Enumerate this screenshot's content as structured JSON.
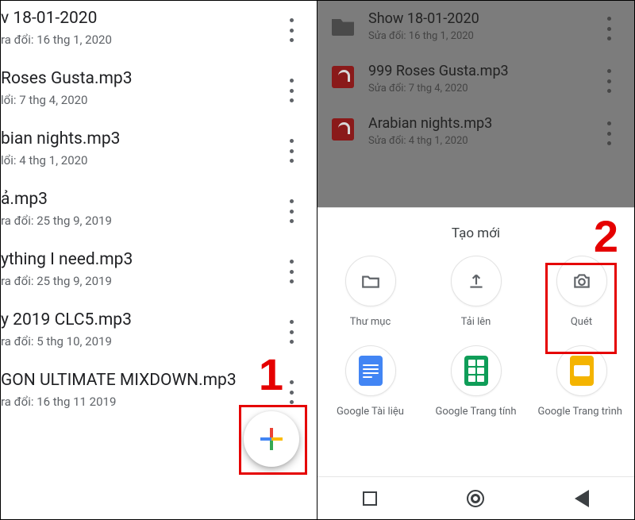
{
  "left": {
    "files": [
      {
        "title": "v 18-01-2020",
        "sub": "ra đổi: 16 thg 1, 2020"
      },
      {
        "title": "Roses Gusta.mp3",
        "sub": "lổi: 7 thg 4, 2020"
      },
      {
        "title": "bian nights.mp3",
        "sub": "lổi: 4 thg 1, 2020"
      },
      {
        "title": "ả.mp3",
        "sub": "ra đổi: 25 thg 9, 2019"
      },
      {
        "title": "ything I need.mp3",
        "sub": "ra đổi: 25 thg 9, 2019"
      },
      {
        "title": "y 2019 CLC5.mp3",
        "sub": "ra đổi: 5 thg 10, 2019"
      },
      {
        "title": "GON ULTIMATE MIXDOWN.mp3",
        "sub": "ra đổi: 16 thg 11  2019"
      }
    ],
    "callout_num": "1"
  },
  "right": {
    "files": [
      {
        "icon": "folder",
        "title": "Show 18-01-2020",
        "sub": "Sửa đổi: 16 thg 1, 2020"
      },
      {
        "icon": "music",
        "title": "999 Roses Gusta.mp3",
        "sub": "Sửa đổi: 7 thg 4, 2020"
      },
      {
        "icon": "music",
        "title": "Arabian nights.mp3",
        "sub": "Sửa đổi: 4 thg 1, 2020"
      }
    ],
    "sheet_title": "Tạo mới",
    "callout_num": "2",
    "actions": [
      {
        "key": "folder",
        "label": "Thư mục"
      },
      {
        "key": "upload",
        "label": "Tải lên"
      },
      {
        "key": "scan",
        "label": "Quét"
      },
      {
        "key": "docs",
        "label": "Google Tài liệu"
      },
      {
        "key": "sheets",
        "label": "Google Trang tính"
      },
      {
        "key": "slides",
        "label": "Google Trang trình b"
      }
    ]
  }
}
